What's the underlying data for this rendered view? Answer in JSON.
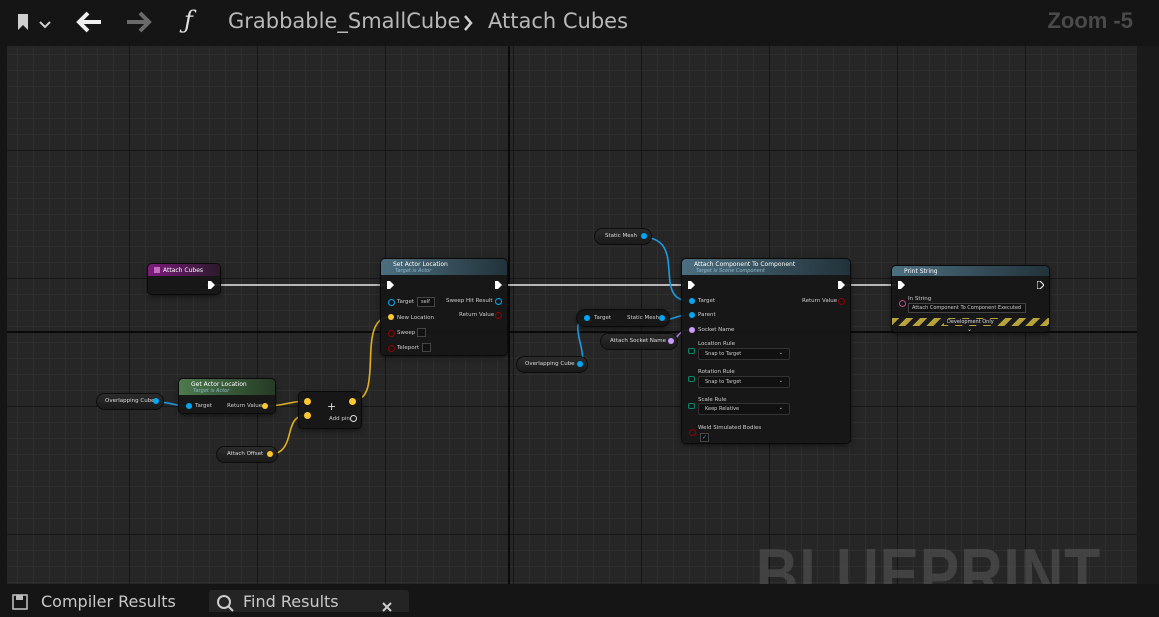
{
  "header": {
    "function_name": "Grabbable_SmallCube",
    "separator": ">",
    "graph_name": "Attach Cubes",
    "zoom": "Zoom -5",
    "function_glyph": "ƒ"
  },
  "watermark": "BLUEPRINT",
  "bottom_tabs": [
    {
      "label": "Compiler Results"
    },
    {
      "label": "Find Results"
    }
  ],
  "nodes": {
    "attach_cubes": {
      "title": "Attach Cubes"
    },
    "set_actor_location": {
      "title": "Set Actor Location",
      "subtitle": "Target is Actor",
      "pins": {
        "target": "Target",
        "target_default": "self",
        "new_location": "New Location",
        "sweep": "Sweep",
        "teleport": "Teleport",
        "sweep_hit": "Sweep Hit Result",
        "return_value": "Return Value"
      }
    },
    "get_actor_location": {
      "title": "Get Actor Location",
      "subtitle": "Target is Actor",
      "pins": {
        "target": "Target",
        "return_value": "Return Value"
      }
    },
    "add": {
      "symbol": "+",
      "add_pin": "Add pin"
    },
    "overlapping_cube_1": {
      "label": "Overlapping Cube"
    },
    "overlapping_cube_2": {
      "label": "Overlapping Cube"
    },
    "attach_offset": {
      "label": "Attach Offset"
    },
    "static_mesh_var": {
      "label": "Static Mesh"
    },
    "get_static_mesh": {
      "target": "Target",
      "output": "Static Mesh"
    },
    "attach_socket_name": {
      "label": "Attach Socket Name"
    },
    "attach_component": {
      "title": "Attach Component To Component",
      "subtitle": "Target is Scene Component",
      "pins": {
        "target": "Target",
        "parent": "Parent",
        "socket_name": "Socket Name",
        "location_rule": "Location Rule",
        "location_value": "Snap to Target",
        "rotation_rule": "Rotation Rule",
        "rotation_value": "Snap to Target",
        "scale_rule": "Scale Rule",
        "scale_value": "Keep Relative",
        "weld": "Weld Simulated Bodies",
        "return_value": "Return Value"
      }
    },
    "print_string": {
      "title": "Print String",
      "in_string_label": "In String",
      "in_string_value": "Attach Component To Component Executed",
      "dev_only": "Development Only"
    }
  },
  "colors": {
    "exec": "#ffffff",
    "object_pin": "#00a8f3",
    "vector_pin": "#fdc82f",
    "name_pin": "#cc99ff",
    "bool_pin": "#920101",
    "function_header": "#4c6f80",
    "pure_header": "#4d7a4d",
    "event_header": "#7c1b7c"
  }
}
